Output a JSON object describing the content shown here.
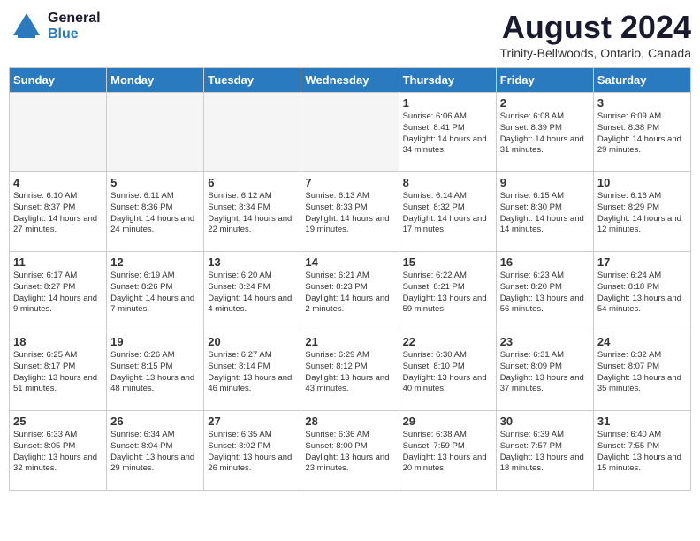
{
  "header": {
    "logo_general": "General",
    "logo_blue": "Blue",
    "month": "August 2024",
    "location": "Trinity-Bellwoods, Ontario, Canada"
  },
  "days_of_week": [
    "Sunday",
    "Monday",
    "Tuesday",
    "Wednesday",
    "Thursday",
    "Friday",
    "Saturday"
  ],
  "weeks": [
    [
      {
        "day": "",
        "info": ""
      },
      {
        "day": "",
        "info": ""
      },
      {
        "day": "",
        "info": ""
      },
      {
        "day": "",
        "info": ""
      },
      {
        "day": "1",
        "info": "Sunrise: 6:06 AM\nSunset: 8:41 PM\nDaylight: 14 hours\nand 34 minutes."
      },
      {
        "day": "2",
        "info": "Sunrise: 6:08 AM\nSunset: 8:39 PM\nDaylight: 14 hours\nand 31 minutes."
      },
      {
        "day": "3",
        "info": "Sunrise: 6:09 AM\nSunset: 8:38 PM\nDaylight: 14 hours\nand 29 minutes."
      }
    ],
    [
      {
        "day": "4",
        "info": "Sunrise: 6:10 AM\nSunset: 8:37 PM\nDaylight: 14 hours\nand 27 minutes."
      },
      {
        "day": "5",
        "info": "Sunrise: 6:11 AM\nSunset: 8:36 PM\nDaylight: 14 hours\nand 24 minutes."
      },
      {
        "day": "6",
        "info": "Sunrise: 6:12 AM\nSunset: 8:34 PM\nDaylight: 14 hours\nand 22 minutes."
      },
      {
        "day": "7",
        "info": "Sunrise: 6:13 AM\nSunset: 8:33 PM\nDaylight: 14 hours\nand 19 minutes."
      },
      {
        "day": "8",
        "info": "Sunrise: 6:14 AM\nSunset: 8:32 PM\nDaylight: 14 hours\nand 17 minutes."
      },
      {
        "day": "9",
        "info": "Sunrise: 6:15 AM\nSunset: 8:30 PM\nDaylight: 14 hours\nand 14 minutes."
      },
      {
        "day": "10",
        "info": "Sunrise: 6:16 AM\nSunset: 8:29 PM\nDaylight: 14 hours\nand 12 minutes."
      }
    ],
    [
      {
        "day": "11",
        "info": "Sunrise: 6:17 AM\nSunset: 8:27 PM\nDaylight: 14 hours\nand 9 minutes."
      },
      {
        "day": "12",
        "info": "Sunrise: 6:19 AM\nSunset: 8:26 PM\nDaylight: 14 hours\nand 7 minutes."
      },
      {
        "day": "13",
        "info": "Sunrise: 6:20 AM\nSunset: 8:24 PM\nDaylight: 14 hours\nand 4 minutes."
      },
      {
        "day": "14",
        "info": "Sunrise: 6:21 AM\nSunset: 8:23 PM\nDaylight: 14 hours\nand 2 minutes."
      },
      {
        "day": "15",
        "info": "Sunrise: 6:22 AM\nSunset: 8:21 PM\nDaylight: 13 hours\nand 59 minutes."
      },
      {
        "day": "16",
        "info": "Sunrise: 6:23 AM\nSunset: 8:20 PM\nDaylight: 13 hours\nand 56 minutes."
      },
      {
        "day": "17",
        "info": "Sunrise: 6:24 AM\nSunset: 8:18 PM\nDaylight: 13 hours\nand 54 minutes."
      }
    ],
    [
      {
        "day": "18",
        "info": "Sunrise: 6:25 AM\nSunset: 8:17 PM\nDaylight: 13 hours\nand 51 minutes."
      },
      {
        "day": "19",
        "info": "Sunrise: 6:26 AM\nSunset: 8:15 PM\nDaylight: 13 hours\nand 48 minutes."
      },
      {
        "day": "20",
        "info": "Sunrise: 6:27 AM\nSunset: 8:14 PM\nDaylight: 13 hours\nand 46 minutes."
      },
      {
        "day": "21",
        "info": "Sunrise: 6:29 AM\nSunset: 8:12 PM\nDaylight: 13 hours\nand 43 minutes."
      },
      {
        "day": "22",
        "info": "Sunrise: 6:30 AM\nSunset: 8:10 PM\nDaylight: 13 hours\nand 40 minutes."
      },
      {
        "day": "23",
        "info": "Sunrise: 6:31 AM\nSunset: 8:09 PM\nDaylight: 13 hours\nand 37 minutes."
      },
      {
        "day": "24",
        "info": "Sunrise: 6:32 AM\nSunset: 8:07 PM\nDaylight: 13 hours\nand 35 minutes."
      }
    ],
    [
      {
        "day": "25",
        "info": "Sunrise: 6:33 AM\nSunset: 8:05 PM\nDaylight: 13 hours\nand 32 minutes."
      },
      {
        "day": "26",
        "info": "Sunrise: 6:34 AM\nSunset: 8:04 PM\nDaylight: 13 hours\nand 29 minutes."
      },
      {
        "day": "27",
        "info": "Sunrise: 6:35 AM\nSunset: 8:02 PM\nDaylight: 13 hours\nand 26 minutes."
      },
      {
        "day": "28",
        "info": "Sunrise: 6:36 AM\nSunset: 8:00 PM\nDaylight: 13 hours\nand 23 minutes."
      },
      {
        "day": "29",
        "info": "Sunrise: 6:38 AM\nSunset: 7:59 PM\nDaylight: 13 hours\nand 20 minutes."
      },
      {
        "day": "30",
        "info": "Sunrise: 6:39 AM\nSunset: 7:57 PM\nDaylight: 13 hours\nand 18 minutes."
      },
      {
        "day": "31",
        "info": "Sunrise: 6:40 AM\nSunset: 7:55 PM\nDaylight: 13 hours\nand 15 minutes."
      }
    ]
  ]
}
